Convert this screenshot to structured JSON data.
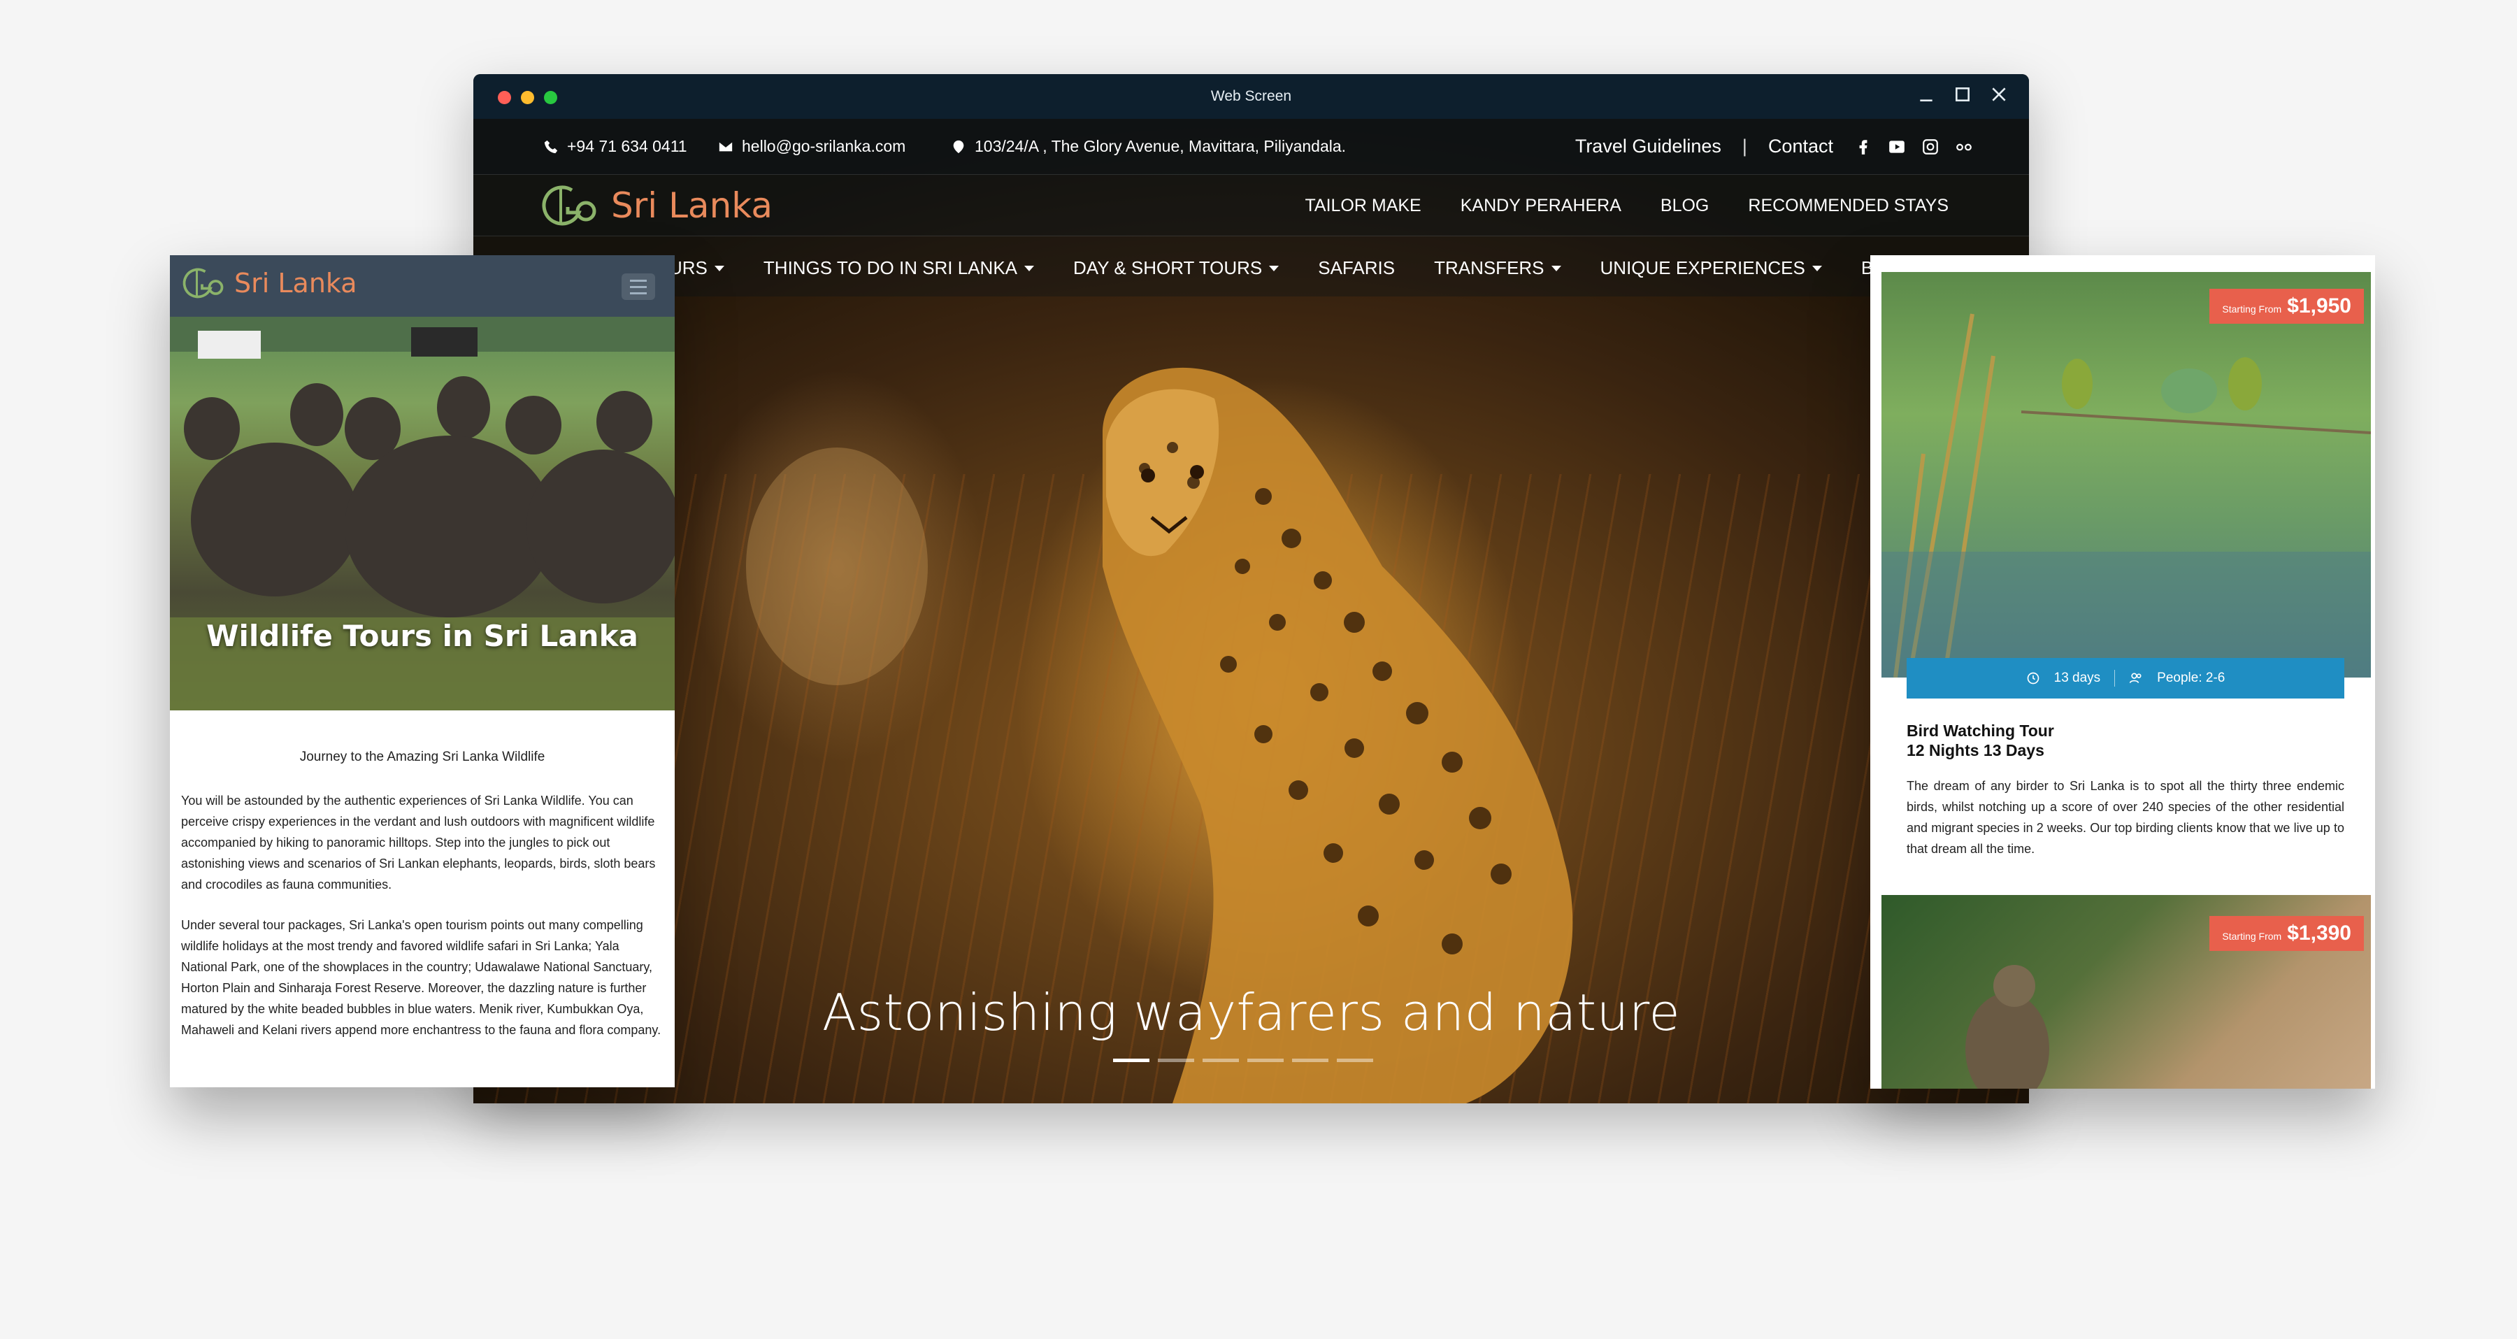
{
  "window": {
    "title": "Web Screen"
  },
  "topbar": {
    "phone": "+94 71 634 0411",
    "email": "hello@go-srilanka.com",
    "address": "103/24/A , The Glory Avenue, Mavittara, Piliyandala.",
    "links": [
      "Travel Guidelines",
      "Contact"
    ]
  },
  "logo": {
    "text": "Sri Lanka"
  },
  "nav_primary": [
    "TAILOR MAKE",
    "KANDY PERAHERA",
    "BLOG",
    "RECOMMENDED STAYS"
  ],
  "nav_secondary": [
    "URS",
    "THINGS TO DO IN SRI LANKA",
    "DAY & SHORT TOURS",
    "SAFARIS",
    "TRANSFERS",
    "UNIQUE EXPERIENCES",
    "BLOG"
  ],
  "hero": {
    "slogan": "Astonishing wayfarers and nature",
    "slides": 6,
    "active_slide": 1
  },
  "mobile_left": {
    "hero_title": "Wildlife Tours in Sri Lanka",
    "subtitle": "Journey to the Amazing Sri Lanka Wildlife",
    "para1": "You will be astounded by the authentic experiences of Sri Lanka Wildlife. You can perceive crispy experiences in the verdant and lush outdoors with magnificent wildlife accompanied by hiking to panoramic hilltops. Step into the jungles to pick out astonishing views and scenarios of Sri Lankan elephants, leopards, birds, sloth bears and crocodiles as fauna communities.",
    "para2": "Under several tour packages, Sri Lanka's open tourism points out many compelling wildlife holidays at the most trendy and favored wildlife safari in Sri Lanka; Yala National Park, one of the showplaces in the country; Udawalawe National Sanctuary, Horton Plain and Sinharaja Forest Reserve. Moreover, the dazzling nature is further matured by the white beaded bubbles in blue waters. Menik river, Kumbukkan Oya, Mahaweli and Kelani rivers append more enchantress to the fauna and flora company."
  },
  "mobile_right": {
    "card1": {
      "price_from": "Starting From",
      "price": "$1,950",
      "days": "13 days",
      "people": "People: 2-6",
      "title_line1": "Bird Watching Tour",
      "title_line2": "12 Nights 13 Days",
      "text": "The dream of any birder to Sri Lanka is to spot all the thirty three endemic birds, whilst notching up a score of over 240 species of the other residential and migrant species in 2 weeks. Our top birding clients know that we live up to that dream all the time."
    },
    "card2": {
      "price_from": "Starting From",
      "price": "$1,390"
    }
  }
}
